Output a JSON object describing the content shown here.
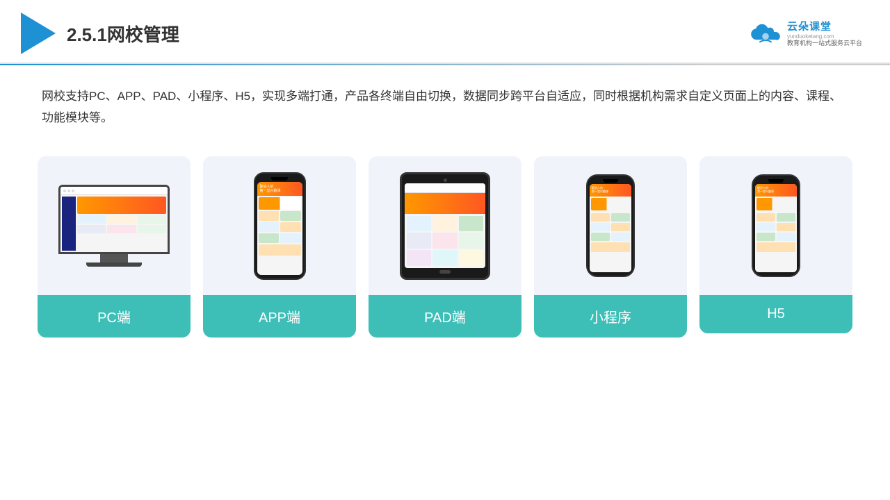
{
  "header": {
    "title": "2.5.1网校管理",
    "brand": {
      "name": "云朵课堂",
      "domain": "yunduoketang.com",
      "tagline": "教育机构一站\n式服务云平台"
    }
  },
  "description": "网校支持PC、APP、PAD、小程序、H5，实现多端打通，产品各终端自由切换，数据同步跨平台自适应，同时根据机构需求自定义页面上的内容、课程、功能模块等。",
  "cards": [
    {
      "id": "pc",
      "label": "PC端"
    },
    {
      "id": "app",
      "label": "APP端"
    },
    {
      "id": "pad",
      "label": "PAD端"
    },
    {
      "id": "miniprogram",
      "label": "小程序"
    },
    {
      "id": "h5",
      "label": "H5"
    }
  ],
  "colors": {
    "accent": "#1e90d4",
    "card_bg": "#eef2f8",
    "card_label_bg": "#3dbfb8",
    "title_color": "#333333",
    "text_color": "#333333"
  }
}
